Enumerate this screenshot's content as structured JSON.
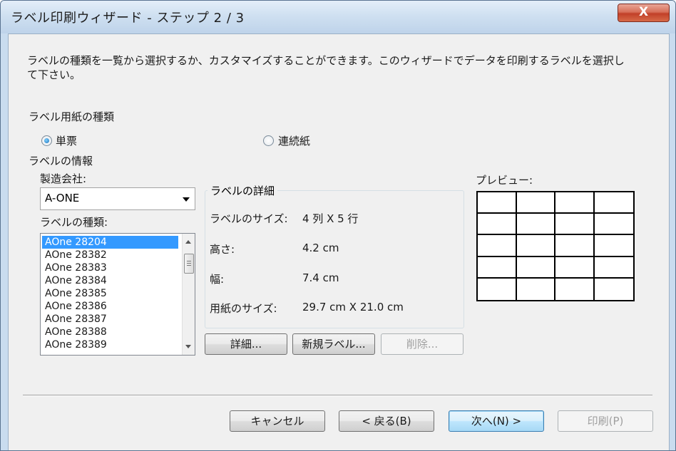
{
  "window": {
    "title": "ラベル印刷ウィザード - ステップ 2 / 3",
    "close_label": "X"
  },
  "description": [
    "ラベルの種類を一覧から選択するか、カスタマイズすることができます。このウィザードでデータを印刷するラベルを選択し",
    "て下さい。"
  ],
  "paper_type": {
    "heading": "ラベル用紙の種類",
    "options": [
      {
        "label": "単票",
        "checked": true
      },
      {
        "label": "連続紙",
        "checked": false
      }
    ]
  },
  "label_info": {
    "heading": "ラベルの情報",
    "manufacturer_label": "製造会社:",
    "manufacturer_value": "A-ONE",
    "type_label": "ラベルの種類:",
    "types": [
      "AOne 28204",
      "AOne 28382",
      "AOne 28383",
      "AOne 28384",
      "AOne 28385",
      "AOne 28386",
      "AOne 28387",
      "AOne 28388",
      "AOne 28389"
    ],
    "selected_index": 0
  },
  "details": {
    "heading": "ラベルの詳細",
    "rows": [
      {
        "label": "ラベルのサイズ:",
        "value": "4 列 X 5 行"
      },
      {
        "label": "高さ:",
        "value": "4.2 cm"
      },
      {
        "label": "幅:",
        "value": "7.4 cm"
      },
      {
        "label": "用紙のサイズ:",
        "value": "29.7 cm X 21.0 cm"
      }
    ],
    "buttons": {
      "detail": "詳細...",
      "new_label": "新規ラベル...",
      "delete": "削除..."
    }
  },
  "preview": {
    "label": "プレビュー:",
    "columns": 4,
    "rows": 5
  },
  "footer": {
    "cancel": "キャンセル",
    "back": "< 戻る(B)",
    "next": "次へ(N) >",
    "print": "印刷(P)"
  }
}
